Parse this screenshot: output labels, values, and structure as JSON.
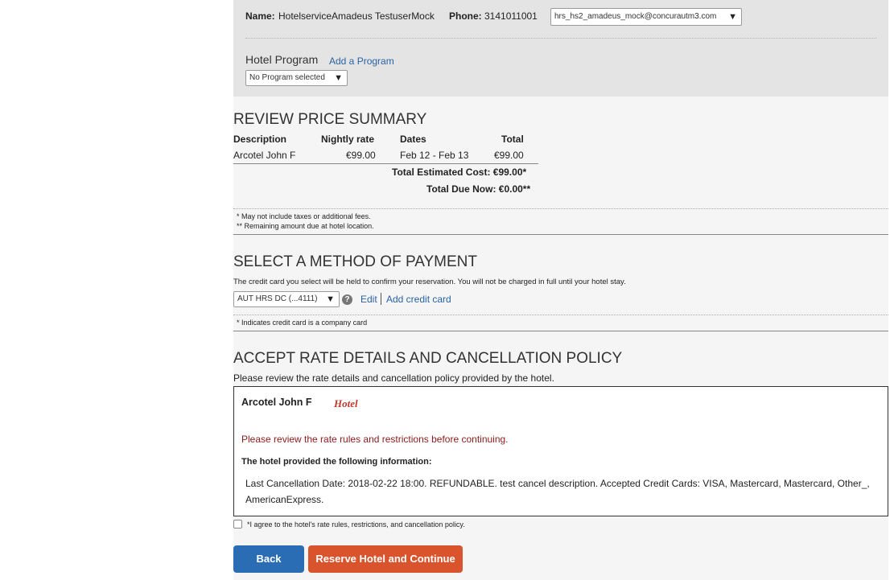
{
  "traveler": {
    "name_label": "Name:",
    "name_value": "HotelserviceAmadeus TestuserMock",
    "phone_label": "Phone:",
    "phone_value": "3141011001",
    "email_selected": "hrs_hs2_amadeus_mock@concurautm3.com",
    "hotel_program_label": "Hotel Program",
    "add_program_link": "Add a Program",
    "program_selected": "No Program selected"
  },
  "price_summary": {
    "title": "REVIEW PRICE SUMMARY",
    "columns": [
      "Description",
      "Nightly rate",
      "Dates",
      "Total"
    ],
    "rows": [
      {
        "description": "Arcotel John F",
        "nightly_rate": "€99.00",
        "dates": "Feb 12 - Feb 13",
        "total": "€99.00"
      }
    ],
    "total_estimated": "Total Estimated Cost: €99.00*",
    "total_due": "Total Due Now: €0.00**",
    "footnote1": "* May not include taxes or additional fees.",
    "footnote2": "** Remaining amount due at hotel location."
  },
  "payment": {
    "title": "SELECT A METHOD OF PAYMENT",
    "description": "The credit card you select will be held to confirm your reservation. You will not be charged in full until your hotel stay.",
    "card_selected": "AUT HRS DC (...4111)",
    "edit_link": "Edit",
    "add_card_link": "Add credit card",
    "footnote": "* Indicates credit card is a company card"
  },
  "policy": {
    "title": "ACCEPT RATE DETAILS AND CANCELLATION POLICY",
    "intro": "Please review the rate details and cancellation policy provided by the hotel.",
    "hotel_name": "Arcotel John F",
    "hotel_tag": "Hotel",
    "warning": "Please review the rate rules and restrictions before continuing.",
    "info_heading": "The hotel provided the following information:",
    "info_text_line1": "Last Cancellation Date: 2018-02-22 18:00. REFUNDABLE. test cancel description. Accepted Credit Cards: VISA, Mastercard, Mastercard, Other_,",
    "info_text_line2": "AmericanExpress.",
    "agree_label": "*I agree to the hotel's rate rules, restrictions, and cancellation policy."
  },
  "buttons": {
    "back": "Back",
    "reserve": "Reserve Hotel and Continue"
  },
  "colors": {
    "back_button": "#2a6db5",
    "reserve_button": "#d9532c",
    "warning_text": "#8b1a1a",
    "link": "#2a63a3"
  }
}
